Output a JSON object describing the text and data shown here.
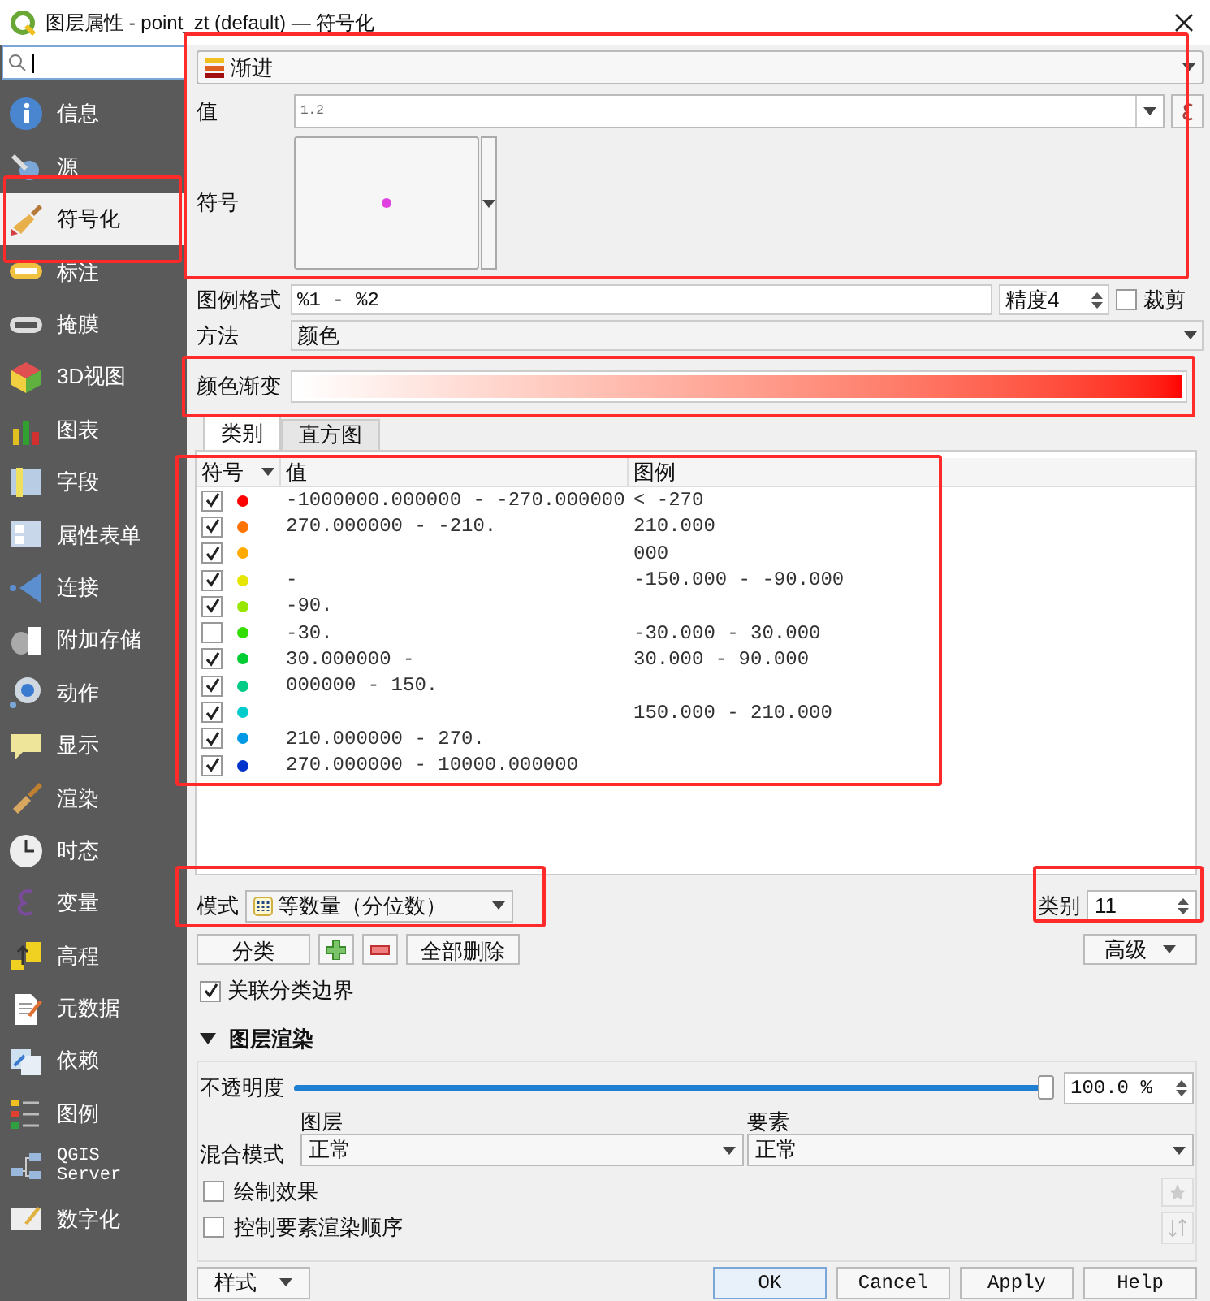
{
  "window": {
    "title": "图层属性 - point_zt (default) — 符号化"
  },
  "sidebar": {
    "items": [
      {
        "label": "信息",
        "selected": false
      },
      {
        "label": "源",
        "selected": false
      },
      {
        "label": "符号化",
        "selected": true
      },
      {
        "label": "标注",
        "selected": false
      },
      {
        "label": "掩膜",
        "selected": false
      },
      {
        "label": "3D视图",
        "selected": false
      },
      {
        "label": "图表",
        "selected": false
      },
      {
        "label": "字段",
        "selected": false
      },
      {
        "label": "属性表单",
        "selected": false
      },
      {
        "label": "连接",
        "selected": false
      },
      {
        "label": "附加存储",
        "selected": false
      },
      {
        "label": "动作",
        "selected": false
      },
      {
        "label": "显示",
        "selected": false
      },
      {
        "label": "渲染",
        "selected": false
      },
      {
        "label": "时态",
        "selected": false
      },
      {
        "label": "变量",
        "selected": false
      },
      {
        "label": "高程",
        "selected": false
      },
      {
        "label": "元数据",
        "selected": false
      },
      {
        "label": "依赖",
        "selected": false
      },
      {
        "label": "图例",
        "selected": false
      },
      {
        "label": "QGIS Server",
        "selected": false
      },
      {
        "label": "数字化",
        "selected": false
      }
    ]
  },
  "renderer": "渐进",
  "value": {
    "label": "值",
    "text": "1.2"
  },
  "symbol": {
    "label": "符号"
  },
  "legend_format": {
    "label": "图例格式",
    "value": "%1 - %2",
    "precision": "精度4",
    "trim_label": "裁剪",
    "trim": false
  },
  "method": {
    "label": "方法",
    "value": "颜色"
  },
  "color_ramp": {
    "label": "颜色渐变"
  },
  "tabs": [
    {
      "label": "类别",
      "selected": true
    },
    {
      "label": "直方图",
      "selected": false
    }
  ],
  "table": {
    "columns": [
      "符号",
      "值",
      "图例"
    ],
    "rows": [
      {
        "checked": true,
        "color": "#ff0000",
        "value": "-1000000.000000 - -270.000000",
        "legend": "< -270"
      },
      {
        "checked": true,
        "color": "#ff7300",
        "value": "270.000000 - -210.",
        "legend": "210.000"
      },
      {
        "checked": true,
        "color": "#ffaa00",
        "legend": "000"
      },
      {
        "checked": true,
        "color": "#e5e500",
        "value": "-",
        "legend": "-150.000 - -90.000"
      },
      {
        "checked": true,
        "color": "#99e600",
        "value": "-90."
      },
      {
        "checked": false,
        "color": "#33dd00",
        "value": "-30.",
        "legend": "-30.000 - 30.000"
      },
      {
        "checked": true,
        "color": "#00cc33",
        "value": "30.000000 -",
        "legend": "30.000 - 90.000"
      },
      {
        "checked": true,
        "color": "#00cc88",
        "value": "000000 - 150."
      },
      {
        "checked": true,
        "color": "#00cccc",
        "legend": "150.000 - 210.000"
      },
      {
        "checked": true,
        "color": "#0099e6",
        "value": "210.000000 - 270."
      },
      {
        "checked": true,
        "color": "#0033cc",
        "value": "270.000000 - 10000.000000"
      }
    ]
  },
  "mode": {
    "label": "模式",
    "value": "等数量（分位数）"
  },
  "classes": {
    "label": "类别",
    "value": "11"
  },
  "buttons": {
    "classify": "分类",
    "delete_all": "全部删除",
    "advanced": "高级"
  },
  "link_boundaries": {
    "label": "关联分类边界",
    "checked": true
  },
  "layer_rendering": {
    "title": "图层渲染",
    "expanded": true,
    "opacity": {
      "label": "不透明度",
      "level": 1,
      "reading": "100.0 %"
    },
    "blending": {
      "label": "混合模式",
      "layer_label": "图层",
      "layer_value": "正常",
      "feature_label": "要素",
      "feature_value": "正常"
    },
    "draw_effects": {
      "label": "绘制效果",
      "checked": false
    },
    "control_order": {
      "label": "控制要素渲染顺序",
      "checked": false
    }
  },
  "footer": {
    "style": "样式",
    "ok": "OK",
    "cancel": "Cancel",
    "apply": "Apply",
    "help": "Help"
  }
}
